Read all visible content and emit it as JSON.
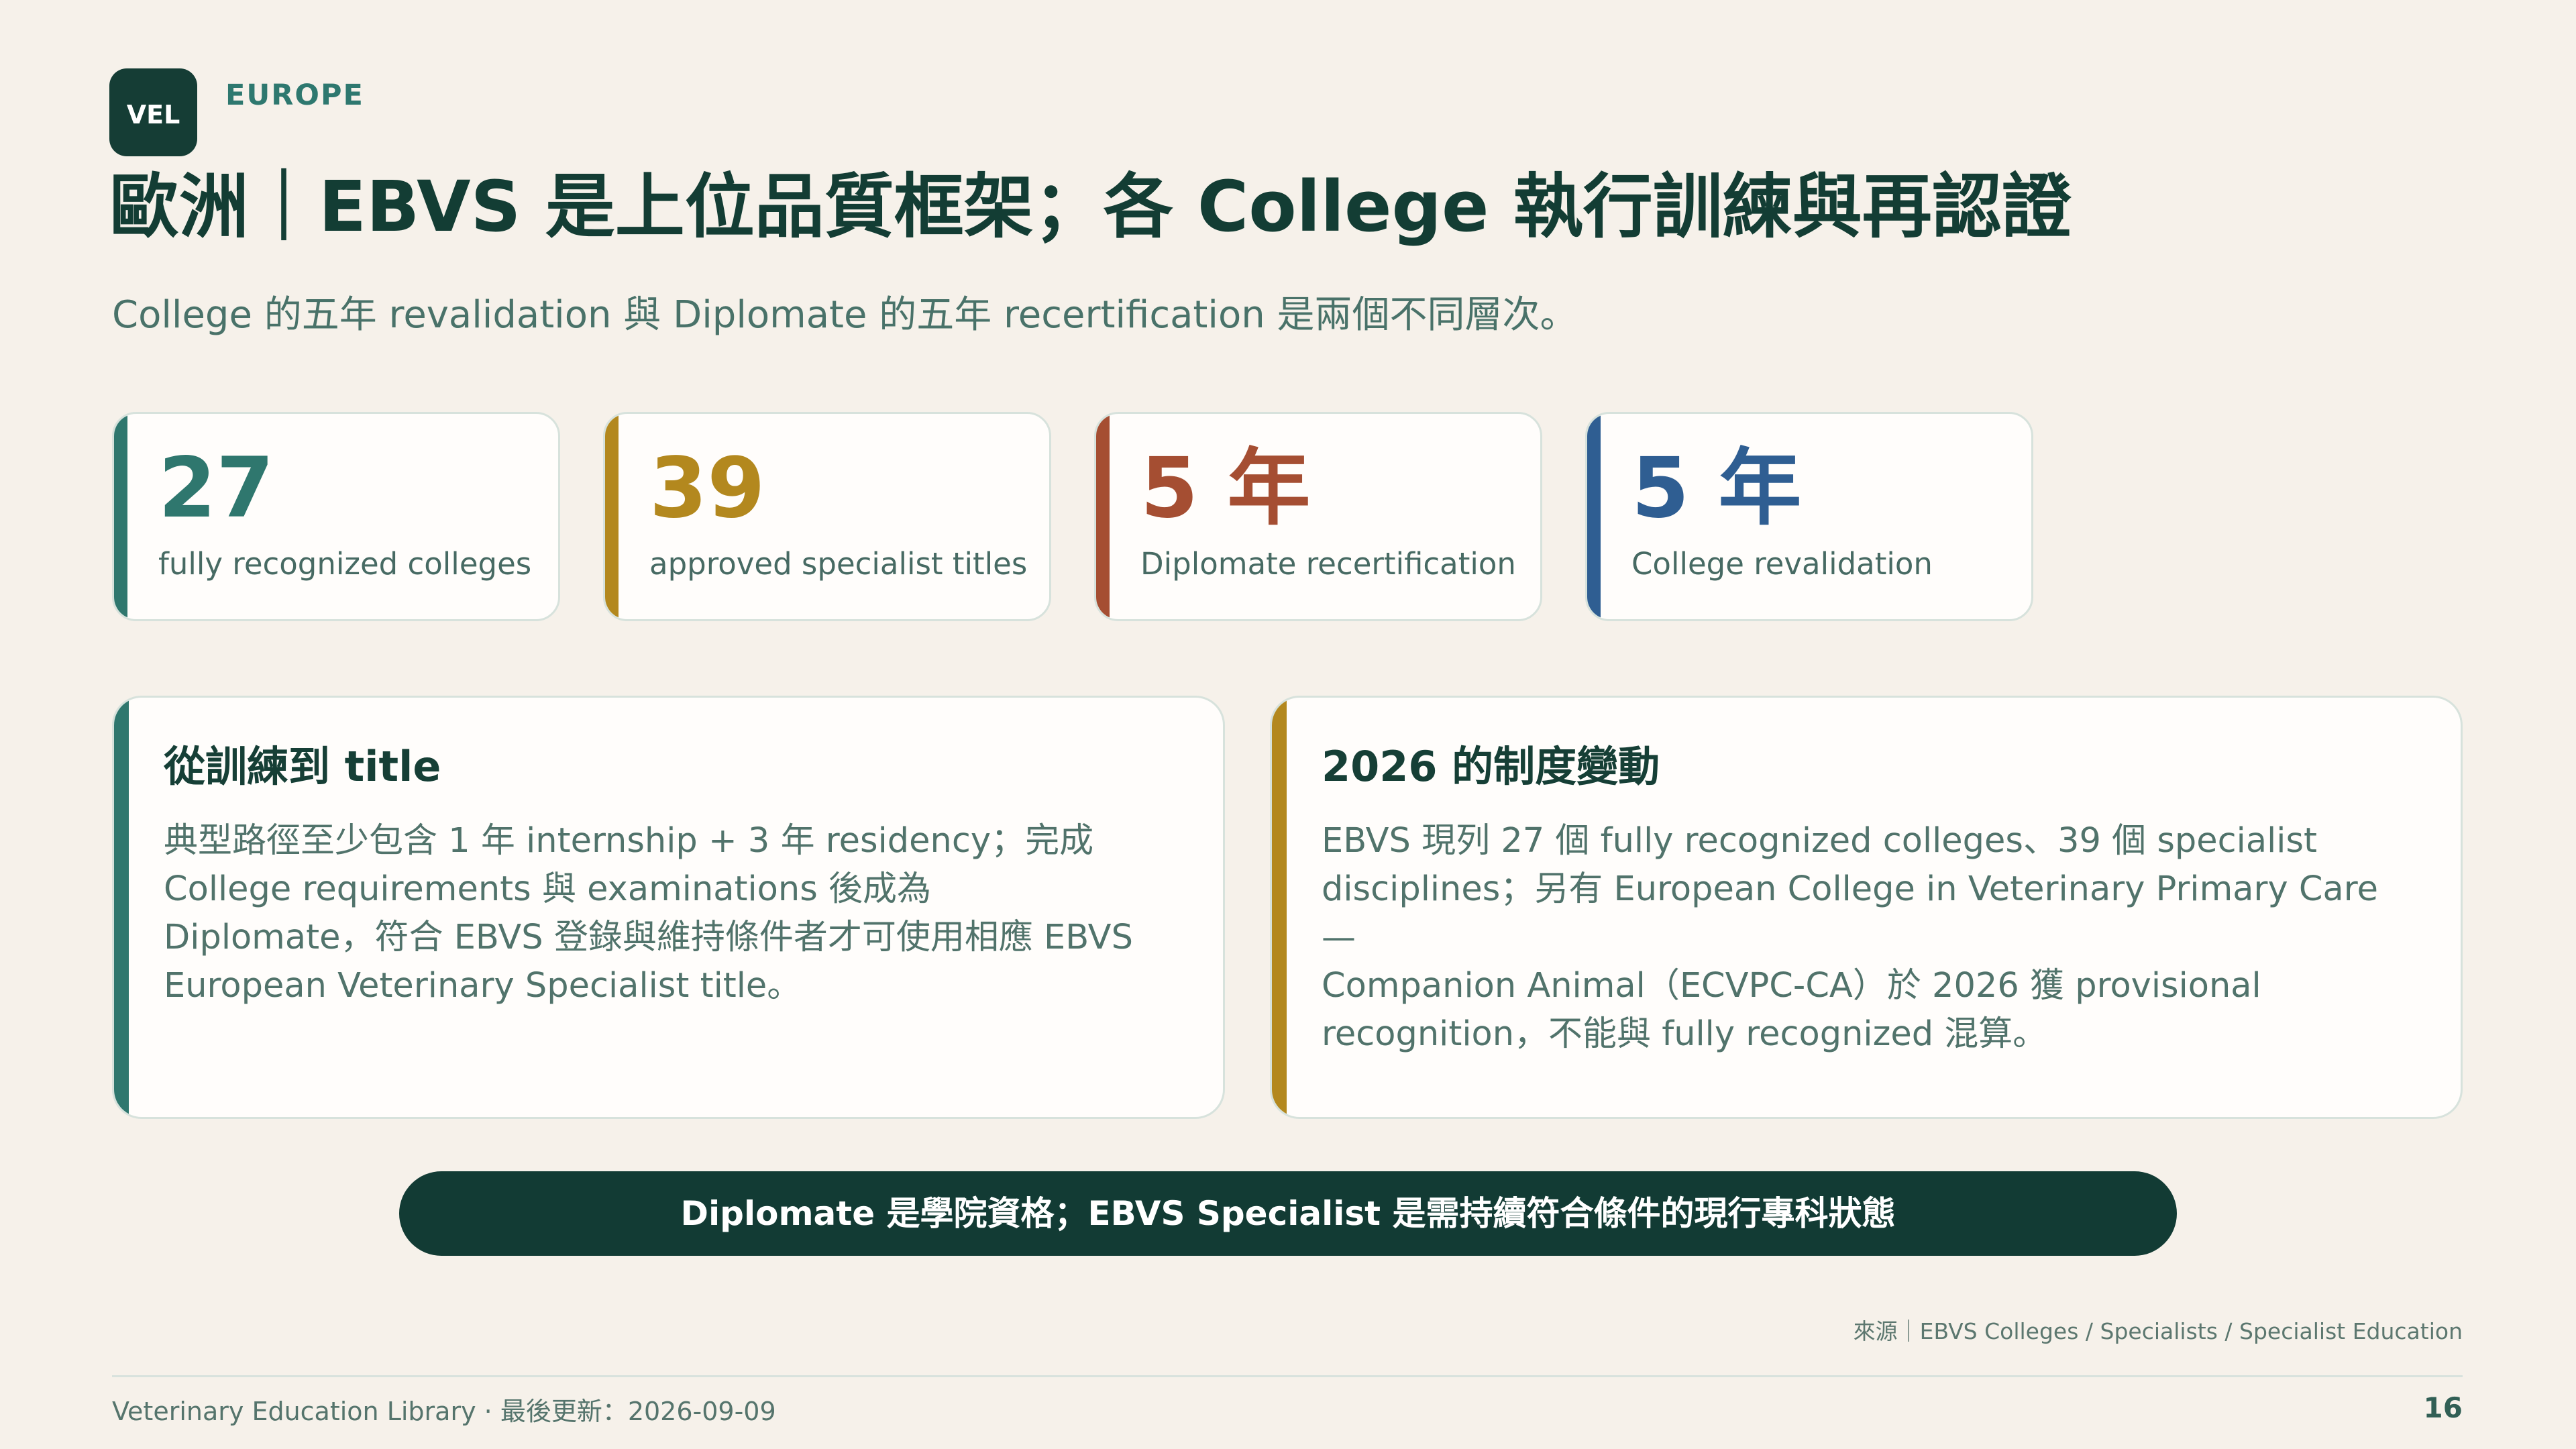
{
  "logo": {
    "text": "VEL"
  },
  "region": "EUROPE",
  "title": "歐洲｜EBVS 是上位品質框架；各 College 執行訓練與再認證",
  "subtitle": "College 的五年 revalidation 與 Diplomate 的五年 recertification 是兩個不同層次。",
  "metrics": [
    {
      "value": "27",
      "label": "fully recognized colleges",
      "accent": "#2f776e"
    },
    {
      "value": "39",
      "label": "approved specialist titles",
      "accent": "#b3881e"
    },
    {
      "value": "5 年",
      "label": "Diplomate recertification",
      "accent": "#a54e32"
    },
    {
      "value": "5 年",
      "label": "College revalidation",
      "accent": "#2f5e92"
    }
  ],
  "cards": [
    {
      "title": "從訓練到 title",
      "body": "典型路徑至少包含 1 年 internship + 3 年 residency；完成\nCollege requirements 與 examinations 後成為\nDiplomate，符合 EBVS 登錄與維持條件者才可使用相應 EBVS\nEuropean Veterinary Specialist title。",
      "accent": "#2f776e"
    },
    {
      "title": "2026 的制度變動",
      "body": "EBVS 現列 27 個 fully recognized colleges、39 個 specialist\ndisciplines；另有 European College in Veterinary Primary Care —\nCompanion Animal（ECVPC-CA）於 2026 獲 provisional\nrecognition，不能與 fully recognized 混算。",
      "accent": "#b3881e"
    }
  ],
  "banner": "Diplomate 是學院資格；EBVS Specialist 是需持續符合條件的現行專科狀態",
  "source": "來源｜EBVS Colleges / Specialists / Specialist Education",
  "footer": {
    "text": "Veterinary Education Library · 最後更新：2026-09-09",
    "page": "16"
  }
}
